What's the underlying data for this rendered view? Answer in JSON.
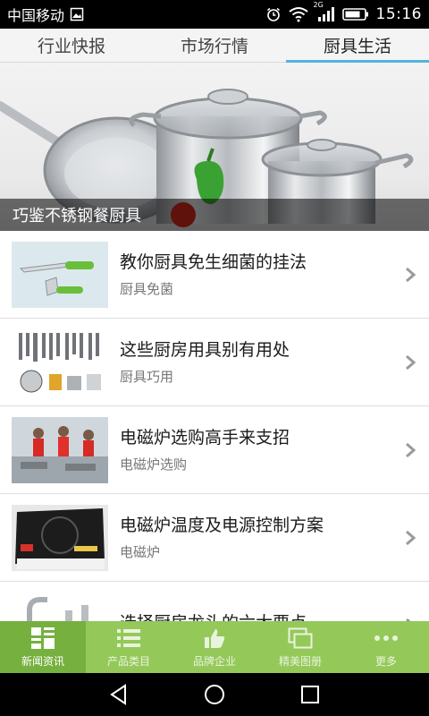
{
  "status_bar": {
    "carrier": "中国移动",
    "network_label": "2G",
    "time": "15:16",
    "icons": [
      "picture-notification-icon",
      "alarm-icon",
      "wifi-icon",
      "signal-icon",
      "battery-icon"
    ]
  },
  "tabs": [
    {
      "label": "行业快报",
      "active": false
    },
    {
      "label": "市场行情",
      "active": false
    },
    {
      "label": "厨具生活",
      "active": true
    }
  ],
  "hero": {
    "caption": "巧鉴不锈钢餐厨具"
  },
  "articles": [
    {
      "title": "教你厨具免生细菌的挂法",
      "subtitle": "厨具免菌",
      "thumb": "knife-peeler-thumbnail"
    },
    {
      "title": "这些厨房用具别有用处",
      "subtitle": "厨具巧用",
      "thumb": "kitchen-utensils-thumbnail"
    },
    {
      "title": "电磁炉选购高手来支招",
      "subtitle": "电磁炉选购",
      "thumb": "cooking-contest-thumbnail"
    },
    {
      "title": "电磁炉温度及电源控制方案",
      "subtitle": "电磁炉",
      "thumb": "induction-cooker-thumbnail"
    },
    {
      "title": "选择厨房龙头的六大要点",
      "subtitle": "",
      "thumb": "faucet-thumbnail"
    }
  ],
  "bottom_nav": [
    {
      "label": "新闻资讯",
      "icon": "news-grid-icon",
      "active": true
    },
    {
      "label": "产品类目",
      "icon": "list-icon",
      "active": false
    },
    {
      "label": "品牌企业",
      "icon": "thumbs-up-icon",
      "active": false
    },
    {
      "label": "精美图册",
      "icon": "gallery-icon",
      "active": false
    },
    {
      "label": "更多",
      "icon": "more-dots-icon",
      "active": false
    }
  ],
  "colors": {
    "tab_indicator": "#55b4de",
    "bottom_nav": "#94c95a",
    "bottom_nav_active": "#76b03e"
  }
}
